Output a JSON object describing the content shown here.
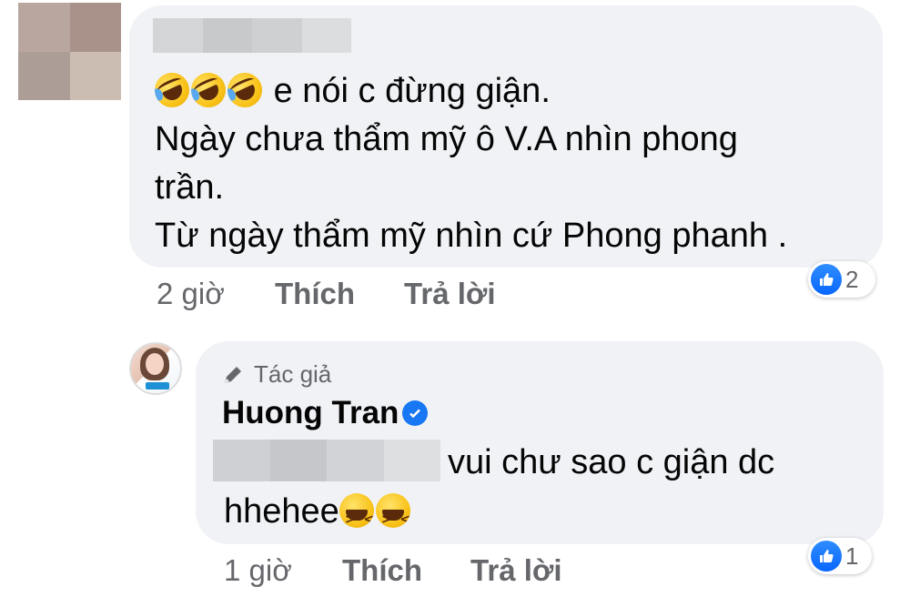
{
  "comments": [
    {
      "author_obscured": true,
      "emojis": [
        "rolling-on-floor-laughing",
        "rolling-on-floor-laughing",
        "rolling-on-floor-laughing"
      ],
      "lines": [
        "e nói c đừng giận.",
        "Ngày chưa thẩm mỹ ô V.A nhìn phong",
        "trần.",
        "Từ ngày thẩm mỹ nhìn cứ Phong phanh ."
      ],
      "time": "2 giờ",
      "like_label": "Thích",
      "reply_label": "Trả lời",
      "reaction": {
        "type": "like",
        "count": "2"
      }
    },
    {
      "author_badge": "Tác giả",
      "author": "Huong Tran",
      "verified": true,
      "mention_obscured": true,
      "text_line_1": "vui chư sao c giận dc",
      "text_line_2": "hhehee",
      "emojis": [
        "grinning-squinting-face",
        "grinning-squinting-face"
      ],
      "time": "1 giờ",
      "like_label": "Thích",
      "reply_label": "Trả lời",
      "reaction": {
        "type": "like",
        "count": "1"
      }
    }
  ],
  "colors": {
    "bubble": "#f0f2f5",
    "meta_text": "#65676b",
    "like_blue": "#0866ff",
    "verified_blue": "#1877f2"
  }
}
